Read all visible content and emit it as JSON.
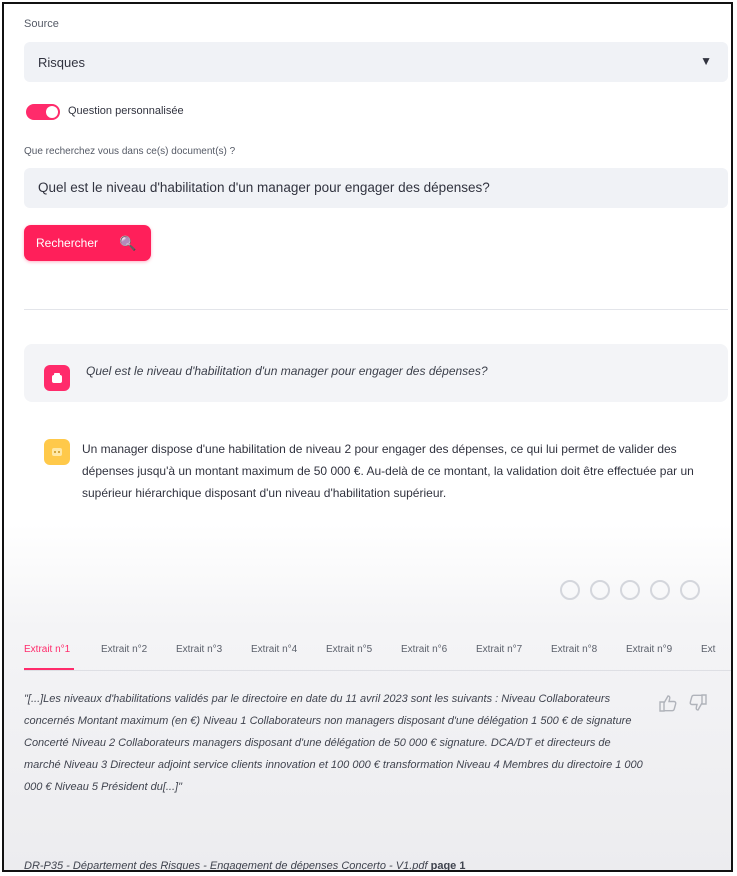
{
  "source": {
    "label": "Source",
    "selected": "Risques"
  },
  "toggle": {
    "label": "Question personnalisée",
    "checked": true
  },
  "query": {
    "label": "Que recherchez vous dans ce(s) document(s) ?",
    "value": "Quel est le niveau d'habilitation d'un manager pour engager des dépenses?"
  },
  "search_button": {
    "label": "Rechercher"
  },
  "conversation": {
    "user_question": "Quel est le niveau d'habilitation d'un manager pour engager des dépenses?",
    "answer": "Un manager dispose d'une habilitation de niveau 2 pour engager des dépenses, ce qui lui permet de valider des dépenses jusqu'à un montant maximum de 50 000 €. Au-delà de ce montant, la validation doit être effectuée par un supérieur hiérarchique disposant d'un niveau d'habilitation supérieur."
  },
  "tabs": [
    "Extrait n°1",
    "Extrait n°2",
    "Extrait n°3",
    "Extrait n°4",
    "Extrait n°5",
    "Extrait n°6",
    "Extrait n°7",
    "Extrait n°8",
    "Extrait n°9",
    "Ext"
  ],
  "extract": {
    "text": "\"[...]Les niveaux d'habilitations validés par le directoire en date du 11 avril 2023 sont les suivants : Niveau Collaborateurs concernés Montant maximum (en €) Niveau 1 Collaborateurs non managers disposant d'une délégation 1 500 € de signature Concerté Niveau 2 Collaborateurs managers disposant d'une délégation de 50 000 € signature. DCA/DT et directeurs de marché Niveau 3 Directeur adjoint service clients innovation et 100 000 € transformation Niveau 4 Membres du directoire 1 000 000 € Niveau 5 Président du[...]\"",
    "source_file": "DR-P35 - Département des Risques - Engagement de dépenses Concerto - V1.pdf",
    "source_page": "page 1"
  },
  "colors": {
    "accent": "#ff2b6b",
    "bot_avatar": "#ffc94a",
    "input_bg": "#f0f2f6"
  }
}
